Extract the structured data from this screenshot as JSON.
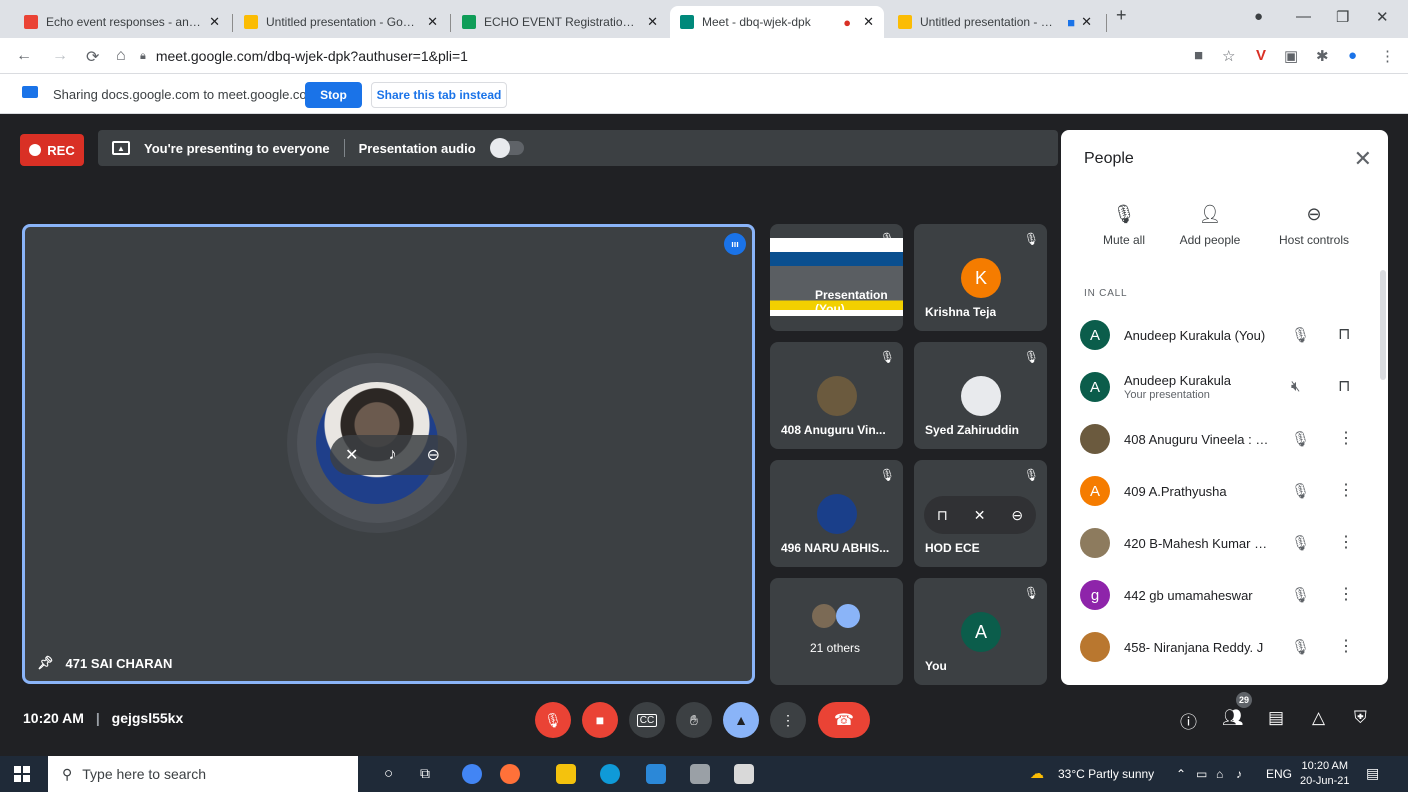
{
  "browser": {
    "tabs": [
      {
        "title": "Echo event responses - anudeep",
        "favicon_color": "#ea4335"
      },
      {
        "title": "Untitled presentation - Google S",
        "favicon_color": "#fbbc04"
      },
      {
        "title": "ECHO EVENT Registration for JAN",
        "favicon_color": "#0f9d58"
      },
      {
        "title": "Meet - dbq-wjek-dpk",
        "favicon_color": "#00897b"
      },
      {
        "title": "Untitled presentation - Goog",
        "favicon_color": "#fbbc04"
      }
    ],
    "url": "meet.google.com/dbq-wjek-dpk?authuser=1&pli=1"
  },
  "sharebar": {
    "text": "Sharing docs.google.com to meet.google.com",
    "stop_label": "Stop",
    "share_tab_label": "Share this tab instead"
  },
  "meet": {
    "rec_label": "REC",
    "presenting_text": "You're presenting to everyone",
    "presentation_audio_label": "Presentation audio",
    "main_speaker": "471 SAI CHARAN",
    "tiles": [
      {
        "name": "Presentation (You)"
      },
      {
        "name": "Krishna Teja",
        "initial": "K",
        "color": "#f57c00"
      },
      {
        "name": "408 Anuguru Vin..."
      },
      {
        "name": "Syed Zahiruddin"
      },
      {
        "name": "496 NARU ABHIS..."
      },
      {
        "name": "HOD ECE"
      },
      {
        "name": "21 others"
      },
      {
        "name": "You",
        "initial": "A",
        "color": "#0b5d4b"
      }
    ],
    "meeting_time": "10:20 AM",
    "meeting_code": "gejgsl55kx",
    "participant_count": "29"
  },
  "people_panel": {
    "title": "People",
    "actions": [
      "Mute all",
      "Add people",
      "Host controls"
    ],
    "section_label": "IN CALL",
    "participants": [
      {
        "name": "Anudeep Kurakula (You)",
        "initial": "A",
        "color": "#0b5d4b"
      },
      {
        "name": "Anudeep Kurakula",
        "sub": "Your presentation",
        "initial": "A",
        "color": "#0b5d4b"
      },
      {
        "name": "408 Anuguru Vineela : ksr...",
        "initial": "",
        "color": "#6b5a3e"
      },
      {
        "name": "409 A.Prathyusha",
        "initial": "A",
        "color": "#f57c00"
      },
      {
        "name": "420 B-Mahesh Kumar Re...",
        "initial": "",
        "color": "#8d7b5e"
      },
      {
        "name": "442 gb umamaheswar",
        "initial": "g",
        "color": "#8e24aa"
      },
      {
        "name": "458- Niranjana Reddy. J",
        "initial": "",
        "color": "#b9772f"
      }
    ]
  },
  "taskbar": {
    "search_placeholder": "Type here to search",
    "weather": "33°C  Partly sunny",
    "lang": "ENG",
    "time": "10:20 AM",
    "date": "20-Jun-21"
  }
}
